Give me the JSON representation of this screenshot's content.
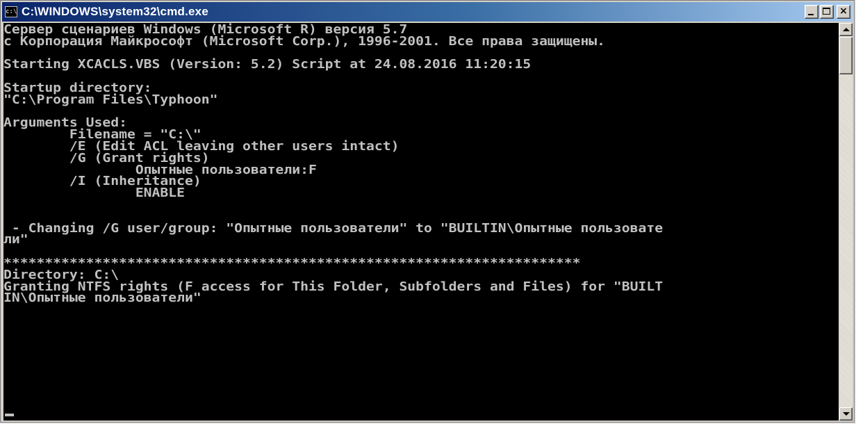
{
  "window": {
    "title": "C:\\WINDOWS\\system32\\cmd.exe",
    "icon_label": "c:\\",
    "controls": [
      "minimize-icon",
      "maximize-icon",
      "close-icon"
    ],
    "close_label": "×"
  },
  "console": {
    "lines": [
      "Сервер сценариев Windows (Microsoft R) версия 5.7",
      "c Корпорация Майкрософт (Microsoft Corp.), 1996-2001. Все права защищены.",
      "",
      "Starting XCACLS.VBS (Version: 5.2) Script at 24.08.2016 11:20:15",
      "",
      "Startup directory:",
      "\"C:\\Program Files\\Typhoon\"",
      "",
      "Arguments Used:",
      "        Filename = \"C:\\\"",
      "        /E (Edit ACL leaving other users intact)",
      "        /G (Grant rights)",
      "                Опытные пользователи:F",
      "        /I (Inheritance)",
      "                ENABLE",
      "",
      "",
      " - Changing /G user/group: \"Опытные пользователи\" to \"BUILTIN\\Опытные пользовате",
      "ли\"",
      "",
      "**********************************************************************",
      "Directory: C:\\",
      "Granting NTFS rights (F access for This Folder, Subfolders and Files) for \"BUILT",
      "IN\\Опытные пользователи\""
    ]
  },
  "colors": {
    "console_bg": "#000000",
    "console_text": "#c0c0c0",
    "titlebar_start": "#0a246a",
    "titlebar_end": "#a6caf0"
  }
}
